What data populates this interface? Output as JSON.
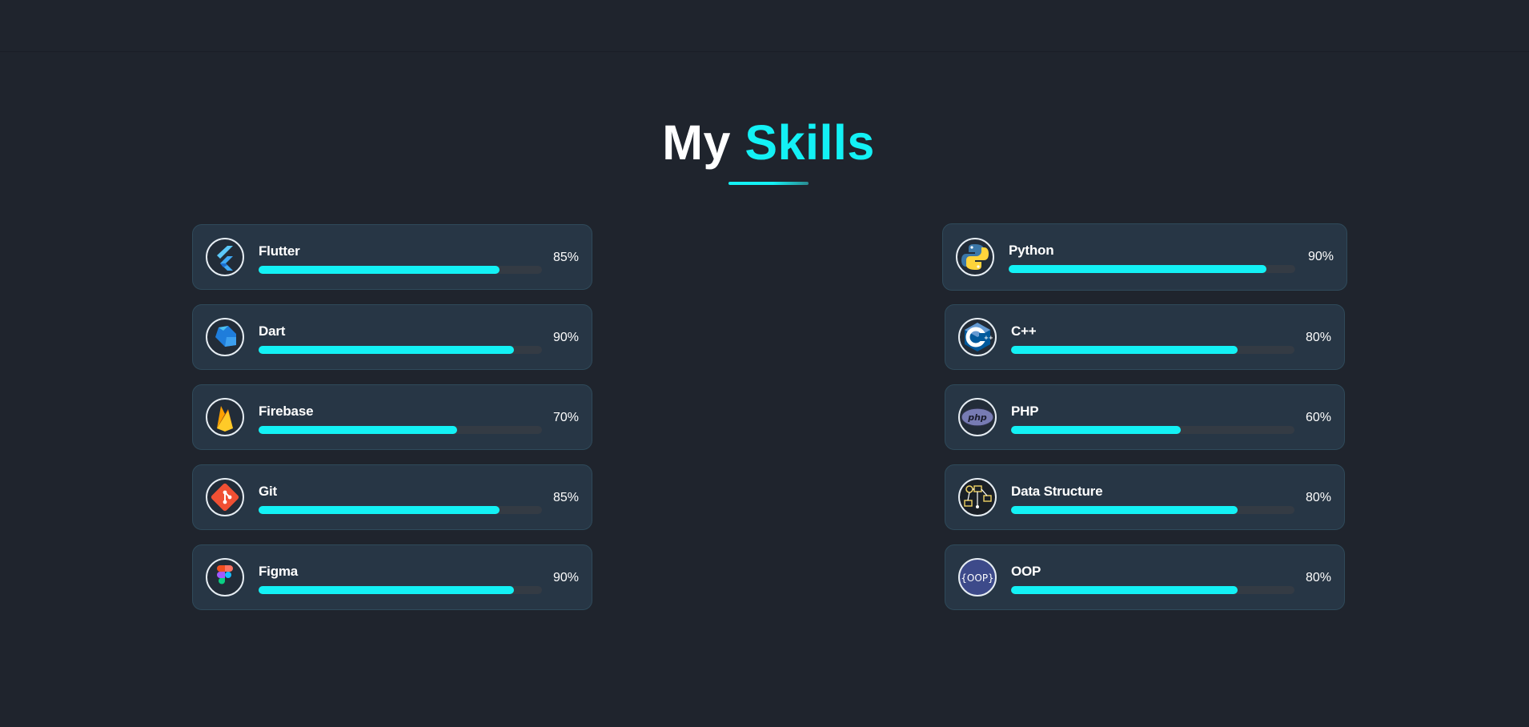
{
  "heading": {
    "title_plain": "My",
    "title_accent": "Skills"
  },
  "colors": {
    "accent": "#13f1f5",
    "background": "#1f242d",
    "card": "#273645",
    "track": "#343b44"
  },
  "skills_left": [
    {
      "name": "Flutter",
      "percent_label": "85%",
      "level": 0.85,
      "icon": "flutter-icon"
    },
    {
      "name": "Dart",
      "percent_label": "90%",
      "level": 0.9,
      "icon": "dart-icon"
    },
    {
      "name": "Firebase",
      "percent_label": "70%",
      "level": 0.7,
      "icon": "firebase-icon"
    },
    {
      "name": "Git",
      "percent_label": "85%",
      "level": 0.85,
      "icon": "git-icon"
    },
    {
      "name": "Figma",
      "percent_label": "90%",
      "level": 0.9,
      "icon": "figma-icon"
    }
  ],
  "skills_right": [
    {
      "name": "Python",
      "percent_label": "90%",
      "level": 0.9,
      "icon": "python-icon"
    },
    {
      "name": "C++",
      "percent_label": "80%",
      "level": 0.8,
      "icon": "cplusplus-icon"
    },
    {
      "name": "PHP",
      "percent_label": "60%",
      "level": 0.6,
      "icon": "php-icon"
    },
    {
      "name": "Data Structure",
      "percent_label": "80%",
      "level": 0.8,
      "icon": "data-structure-icon"
    },
    {
      "name": "OOP",
      "percent_label": "80%",
      "level": 0.8,
      "icon": "oop-icon"
    }
  ]
}
